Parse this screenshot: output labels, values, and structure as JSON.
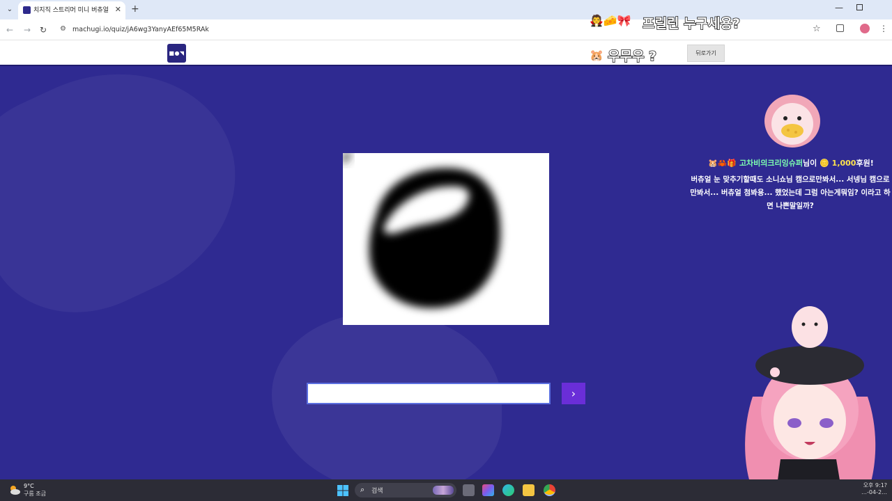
{
  "browser": {
    "tab_title": "치지직 스트리머 미니 버츄얼",
    "tab_close": "✕",
    "new_tab": "+",
    "url": "machugi.io/quiz/jA6wg3YanyAEf65M5RAk",
    "back": "←",
    "forward": "→",
    "reload": "↻",
    "site_info": "⚙",
    "star": "☆",
    "menu": "⋮",
    "minimize": "—"
  },
  "site": {
    "logo_text": "■●◥",
    "back_button": "뒤로가기"
  },
  "overlay": {
    "top_emojis": "🧛🧀🎀",
    "top_text": "프릴린 누구세용?",
    "mid_emoji": "🐹",
    "mid_text": "우무우 ?"
  },
  "quiz": {
    "answer_value": "",
    "submit_label": "›"
  },
  "donation": {
    "prefix_emojis": "🐹🦀🎁",
    "donor_name": "고차비의크리잉슈퍼",
    "suffix": "님이",
    "coin": "🪙",
    "amount": "1,000",
    "amount_suffix": "후원!",
    "message": "버츄얼 눈 맞추기할때도 소니쇼님 캠으로만봐서... 서넹님 캠으로만봐서... 버츄얼 첨봐용... 했었는데 그럼 아는게뭐임? 이라고 하면 나쁜말일까?"
  },
  "taskbar": {
    "temp": "9°C",
    "weather": "구름 조금",
    "search_icon": "⌕",
    "search_text": "검색",
    "time": "오후 9:1?",
    "date": "…-04-2…"
  },
  "colors": {
    "page_bg": "#2f2a91",
    "submit_bg": "#6a2ed8",
    "input_border": "#5b6fe0"
  }
}
